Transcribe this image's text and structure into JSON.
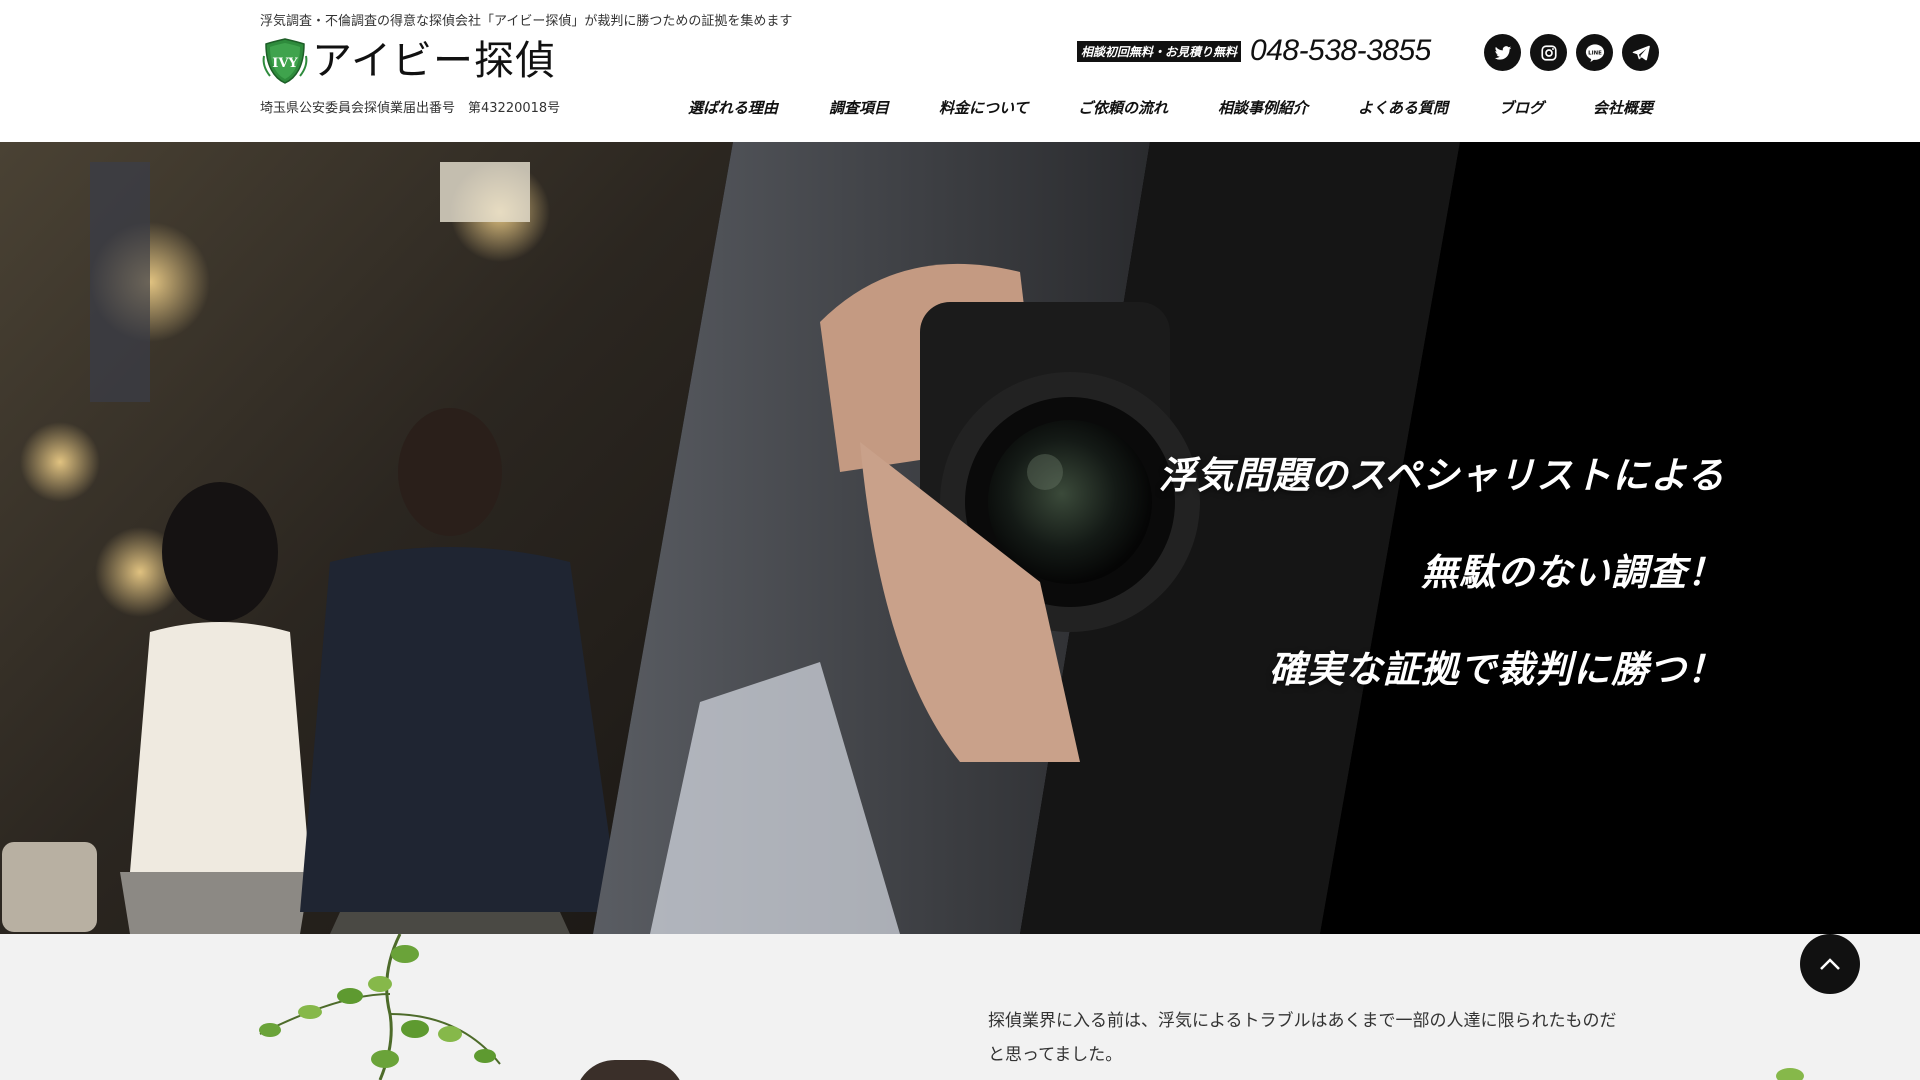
{
  "header": {
    "tagline": "浮気調査・不倫調査の得意な探偵会社「アイビー探偵」が裁判に勝つための証拠を集めます",
    "logo_text": "アイビー探偵",
    "license": "埼玉県公安委員会探偵業届出番号　第43220018号",
    "contact_badge": "相談初回無料・お見積り無料",
    "phone": "048-538-3855"
  },
  "social": [
    {
      "icon": "twitter-icon"
    },
    {
      "icon": "instagram-icon"
    },
    {
      "icon": "line-icon",
      "label": "LINE"
    },
    {
      "icon": "telegram-icon"
    }
  ],
  "nav": {
    "items": [
      {
        "label": "選ばれる理由"
      },
      {
        "label": "調査項目"
      },
      {
        "label": "料金について"
      },
      {
        "label": "ご依頼の流れ"
      },
      {
        "label": "相談事例紹介"
      },
      {
        "label": "よくある質問"
      },
      {
        "label": "ブログ"
      },
      {
        "label": "会社概要"
      }
    ]
  },
  "hero": {
    "lines": [
      "浮気問題のスペシャリストによる",
      "無駄のない調査！",
      "確実な証拠で裁判に勝つ！"
    ]
  },
  "intro": {
    "line1": "探偵業界に入る前は、浮気によるトラブルはあくまで一部の人達に限られたものだ",
    "line2": "と思ってました。"
  },
  "colors": {
    "accent_green": "#2e8b3c",
    "dark": "#111111",
    "section_bg": "#f2f2f2"
  }
}
